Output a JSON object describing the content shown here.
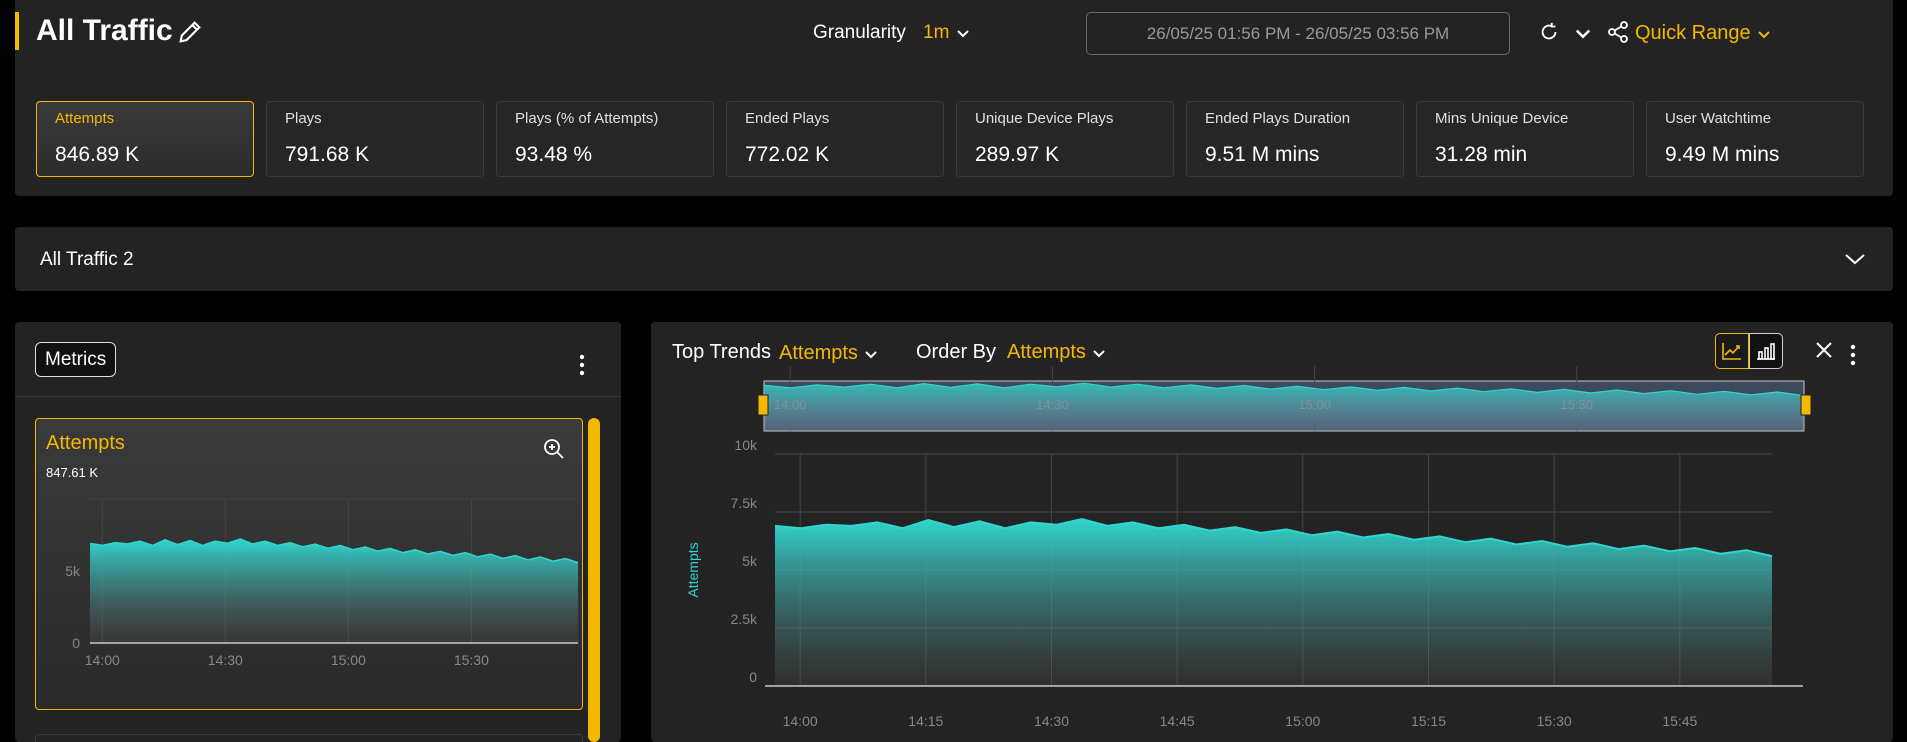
{
  "header": {
    "title": "All Traffic",
    "granularity_label": "Granularity",
    "granularity_value": "1m",
    "date_range": "26/05/25 01:56 PM - 26/05/25 03:56 PM",
    "quick_range": "Quick Range"
  },
  "kpis": [
    {
      "label": "Attempts",
      "value": "846.89 K",
      "active": true
    },
    {
      "label": "Plays",
      "value": "791.68 K"
    },
    {
      "label": "Plays (% of Attempts)",
      "value": "93.48 %"
    },
    {
      "label": "Ended Plays",
      "value": "772.02 K"
    },
    {
      "label": "Unique Device Plays",
      "value": "289.97 K"
    },
    {
      "label": "Ended Plays Duration",
      "value": "9.51 M mins"
    },
    {
      "label": "Mins Unique Device",
      "value": "31.28 min"
    },
    {
      "label": "User Watchtime",
      "value": "9.49 M mins"
    }
  ],
  "section2": {
    "title": "All Traffic 2"
  },
  "metrics_panel": {
    "button": "Metrics",
    "card": {
      "title": "Attempts",
      "subtitle": "847.61 K"
    }
  },
  "trends_panel": {
    "top_trends_label": "Top Trends",
    "top_trends_value": "Attempts",
    "order_by_label": "Order By",
    "order_by_value": "Attempts"
  },
  "colors": {
    "accent": "#f5b800",
    "series": "#2fd6cf",
    "panel": "#232323"
  },
  "chart_data": [
    {
      "type": "area",
      "title": "Attempts",
      "xlabel": "",
      "ylabel": "",
      "x_ticks": [
        "14:00",
        "14:30",
        "15:00",
        "15:30"
      ],
      "y_ticks": [
        "0",
        "5k"
      ],
      "ylim": [
        0,
        10000
      ],
      "x_range": [
        "13:57",
        "15:56"
      ],
      "series": [
        {
          "values": [
            6800,
            6900,
            6850,
            7000,
            6950,
            6900,
            7050,
            6950,
            7000,
            6900,
            6950,
            7050,
            7100,
            7000,
            6950,
            6900,
            6850,
            6800,
            6750,
            6700,
            6650,
            6600,
            6550,
            6500,
            6450,
            6400,
            6350,
            6300,
            6250,
            6200,
            6150,
            6100,
            6050,
            6000,
            5950,
            5900,
            5850,
            5800,
            5750,
            5700
          ]
        }
      ]
    },
    {
      "type": "area",
      "title": "",
      "xlabel": "",
      "ylabel": "Attempts",
      "x_ticks": [
        "14:00",
        "14:15",
        "14:30",
        "14:45",
        "15:00",
        "15:15",
        "15:30",
        "15:45"
      ],
      "y_ticks": [
        "0",
        "2.5k",
        "5k",
        "7.5k",
        "10k"
      ],
      "ylim": [
        0,
        10000
      ],
      "x_range": [
        "13:57",
        "15:56"
      ],
      "series": [
        {
          "values": [
            6800,
            6900,
            6850,
            7000,
            6950,
            6900,
            7050,
            6950,
            7000,
            6900,
            6950,
            7050,
            7100,
            7000,
            6950,
            6900,
            6850,
            6800,
            6750,
            6700,
            6650,
            6600,
            6550,
            6500,
            6450,
            6400,
            6350,
            6300,
            6250,
            6200,
            6150,
            6100,
            6050,
            6000,
            5950,
            5900,
            5850,
            5800,
            5750,
            5700
          ]
        }
      ]
    },
    {
      "type": "area",
      "title": "",
      "x_ticks": [
        "14:00",
        "14:30",
        "15:00",
        "15:30"
      ],
      "series": [
        {
          "values": [
            6800,
            6900,
            6850,
            7000,
            6950,
            6900,
            7050,
            6950,
            7000,
            6900,
            6950,
            7050,
            7100,
            7000,
            6950,
            6900,
            6850,
            6800,
            6750,
            6700,
            6650,
            6600,
            6550,
            6500,
            6450,
            6400,
            6350,
            6300,
            6250,
            6200,
            6150,
            6100,
            6050,
            6000,
            5950,
            5900,
            5850,
            5800,
            5750,
            5700
          ]
        }
      ]
    }
  ]
}
